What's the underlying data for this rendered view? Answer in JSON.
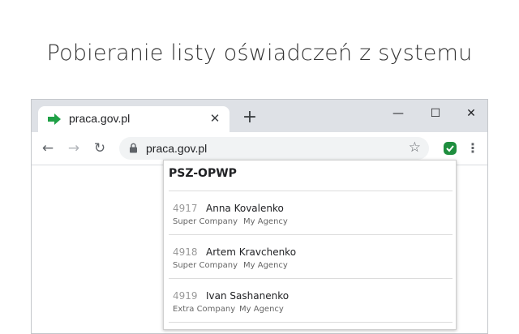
{
  "caption": "Pobieranie listy oświadczeń z systemu",
  "browser": {
    "tab_title": "praca.gov.pl",
    "close_glyph": "✕",
    "newtab_glyph": "+",
    "minimize_glyph": "—",
    "maximize_glyph": "☐",
    "window_close_glyph": "✕",
    "url": "praca.gov.pl",
    "back_glyph": "←",
    "forward_glyph": "→",
    "reload_glyph": "↻",
    "star_glyph": "☆",
    "menu_glyph": "⋮",
    "icons": {
      "favicon": "arrow-right-icon",
      "lock": "lock-icon",
      "extension": "extension-icon"
    },
    "colors": {
      "favicon": "#1fa046",
      "extension": "#1e8e3e"
    }
  },
  "popup": {
    "title": "PSZ-OPWP",
    "items": [
      {
        "id": "4917",
        "name": "Anna Kovalenko",
        "company": "Super Company",
        "agency": "My Agency"
      },
      {
        "id": "4918",
        "name": "Artem Kravchenko",
        "company": "Super Company",
        "agency": "My Agency"
      },
      {
        "id": "4919",
        "name": "Ivan Sashanenko",
        "company": "Extra Company",
        "agency": "My Agency"
      }
    ]
  }
}
